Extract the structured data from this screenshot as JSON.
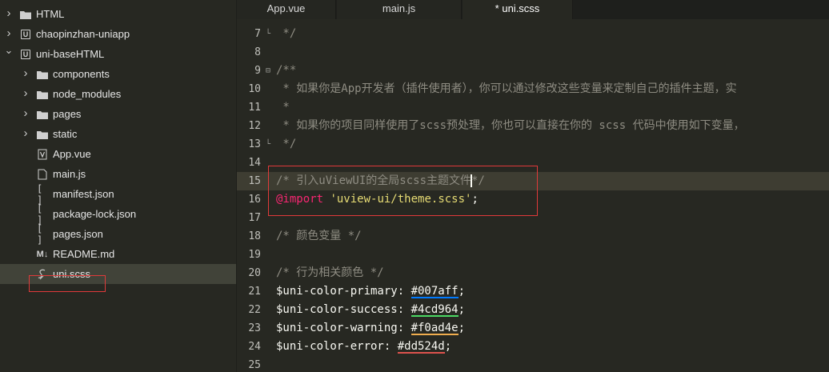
{
  "explorer": {
    "items": [
      {
        "label": "HTML",
        "kind": "folder",
        "level": 0,
        "expanded": false
      },
      {
        "label": "chaopinzhan-uniapp",
        "kind": "project",
        "level": 0,
        "expanded": false
      },
      {
        "label": "uni-baseHTML",
        "kind": "project",
        "level": 0,
        "expanded": true
      },
      {
        "label": "components",
        "kind": "folder",
        "level": 1,
        "expanded": false
      },
      {
        "label": "node_modules",
        "kind": "folder",
        "level": 1,
        "expanded": false
      },
      {
        "label": "pages",
        "kind": "folder",
        "level": 1,
        "expanded": false
      },
      {
        "label": "static",
        "kind": "folder",
        "level": 1,
        "expanded": false
      },
      {
        "label": "App.vue",
        "kind": "vue",
        "level": 1
      },
      {
        "label": "main.js",
        "kind": "js",
        "level": 1
      },
      {
        "label": "manifest.json",
        "kind": "json",
        "level": 1
      },
      {
        "label": "package-lock.json",
        "kind": "json",
        "level": 1
      },
      {
        "label": "pages.json",
        "kind": "json",
        "level": 1
      },
      {
        "label": "README.md",
        "kind": "md",
        "level": 1
      },
      {
        "label": "uni.scss",
        "kind": "scss",
        "level": 1,
        "selected": true
      }
    ],
    "icon_glyphs": {
      "vue": "V",
      "js": "",
      "json": "[ ]",
      "md": "M↓",
      "scss": "ℰ"
    }
  },
  "tabs": [
    {
      "label": "App.vue",
      "active": false
    },
    {
      "label": "main.js",
      "active": false
    },
    {
      "label": "* uni.scss",
      "active": true
    }
  ],
  "editor": {
    "lines": [
      {
        "num": "7",
        "fold": "└",
        "tokens": [
          {
            "t": " */",
            "c": "cmt"
          }
        ]
      },
      {
        "num": "8",
        "tokens": []
      },
      {
        "num": "9",
        "fold": "⊟",
        "tokens": [
          {
            "t": "/**",
            "c": "cmt"
          }
        ]
      },
      {
        "num": "10",
        "tokens": [
          {
            "t": " * 如果你是App开发者（插件使用者），你可以通过修改这些变量来定制自己的插件主题，实",
            "c": "cmt"
          }
        ]
      },
      {
        "num": "11",
        "tokens": [
          {
            "t": " *",
            "c": "cmt"
          }
        ]
      },
      {
        "num": "12",
        "tokens": [
          {
            "t": " * 如果你的项目同样使用了scss预处理，你也可以直接在你的 scss 代码中使用如下变量，",
            "c": "cmt"
          }
        ]
      },
      {
        "num": "13",
        "fold": "└",
        "tokens": [
          {
            "t": " */",
            "c": "cmt"
          }
        ]
      },
      {
        "num": "14",
        "tokens": []
      },
      {
        "num": "15",
        "current": true,
        "tokens": [
          {
            "t": "/* 引入uViewUI的全局scss主题文件",
            "c": "cmt"
          },
          {
            "cursor": true
          },
          {
            "t": "*/",
            "c": "cmt"
          }
        ]
      },
      {
        "num": "16",
        "tokens": [
          {
            "t": "@import",
            "c": "kw"
          },
          {
            "t": " ",
            "c": ""
          },
          {
            "t": "'uview-ui/theme.scss'",
            "c": "str"
          },
          {
            "t": ";",
            "c": ""
          }
        ]
      },
      {
        "num": "17",
        "tokens": []
      },
      {
        "num": "18",
        "tokens": [
          {
            "t": "/* 颜色变量 */",
            "c": "cmt"
          }
        ]
      },
      {
        "num": "19",
        "tokens": []
      },
      {
        "num": "20",
        "tokens": [
          {
            "t": "/* 行为相关颜色 */",
            "c": "cmt"
          }
        ]
      },
      {
        "num": "21",
        "tokens": [
          {
            "t": "$uni-color-primary: ",
            "c": ""
          },
          {
            "t": "#007aff",
            "c": "",
            "swatch": "#007aff"
          },
          {
            "t": ";",
            "c": ""
          }
        ]
      },
      {
        "num": "22",
        "tokens": [
          {
            "t": "$uni-color-success: ",
            "c": ""
          },
          {
            "t": "#4cd964",
            "c": "",
            "swatch": "#4cd964"
          },
          {
            "t": ";",
            "c": ""
          }
        ]
      },
      {
        "num": "23",
        "tokens": [
          {
            "t": "$uni-color-warning: ",
            "c": ""
          },
          {
            "t": "#f0ad4e",
            "c": "",
            "swatch": "#f0ad4e"
          },
          {
            "t": ";",
            "c": ""
          }
        ]
      },
      {
        "num": "24",
        "tokens": [
          {
            "t": "$uni-color-error: ",
            "c": ""
          },
          {
            "t": "#dd524d",
            "c": "",
            "swatch": "#dd524d"
          },
          {
            "t": ";",
            "c": ""
          }
        ]
      },
      {
        "num": "25",
        "tokens": []
      }
    ]
  },
  "colors": {
    "highlight_border": "#e03a3a"
  }
}
